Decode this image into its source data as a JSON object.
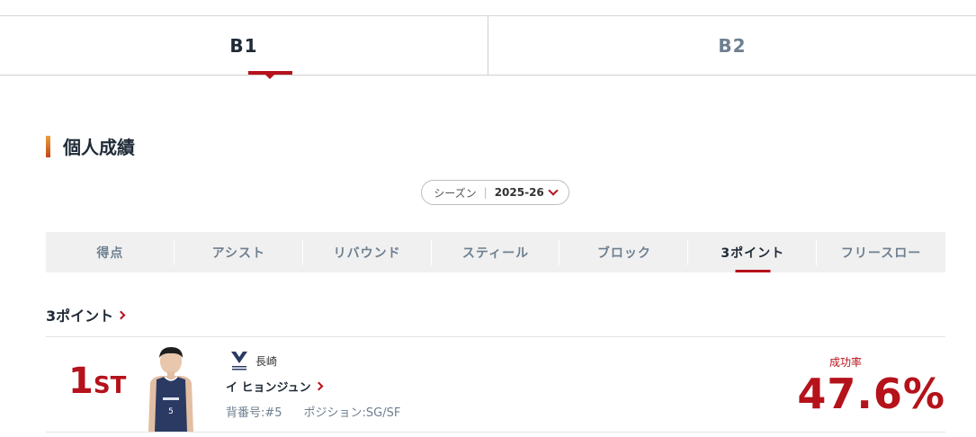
{
  "league_tabs": [
    {
      "label": "B1",
      "active": true
    },
    {
      "label": "B2",
      "active": false
    }
  ],
  "section": {
    "title": "個人成績"
  },
  "season": {
    "label": "シーズン",
    "value": "2025-26",
    "icon": "chevron-down-icon"
  },
  "category_tabs": [
    {
      "label": "得点"
    },
    {
      "label": "アシスト"
    },
    {
      "label": "リバウンド"
    },
    {
      "label": "スティール"
    },
    {
      "label": "ブロック"
    },
    {
      "label": "3ポイント"
    },
    {
      "label": "フリースロー"
    }
  ],
  "active_category": "3ポイント",
  "list": {
    "heading": "3ポイント",
    "entries": [
      {
        "rank_number": "1",
        "rank_suffix": "ST",
        "team_name": "長崎",
        "team_logo": "velca-logo",
        "player_name": "イ ヒョンジュン",
        "jersey": "背番号:#5",
        "position": "ポジション:SG/SF",
        "stat_label": "成功率",
        "stat_value": "47.6%"
      }
    ]
  },
  "colors": {
    "accent": "#b5121b",
    "text_dark": "#1f2a36",
    "text_muted": "#6e7f90",
    "tab_bg": "#f0f0f0",
    "jersey_navy": "#2a3a63"
  }
}
